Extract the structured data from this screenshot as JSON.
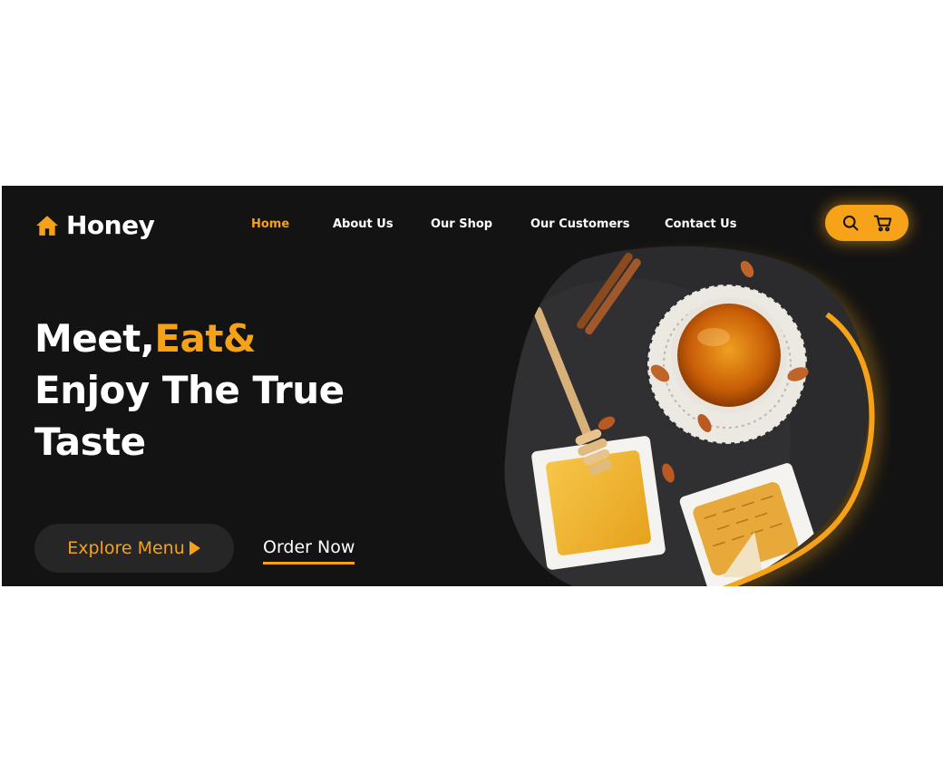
{
  "brand": {
    "name": "Honey",
    "icon": "home-icon",
    "color": "#f5a218"
  },
  "nav": {
    "items": [
      {
        "label": "Home",
        "active": true
      },
      {
        "label": "About Us",
        "active": false
      },
      {
        "label": "Our Shop",
        "active": false
      },
      {
        "label": "Our Customers",
        "active": false
      },
      {
        "label": "Contact Us",
        "active": false
      }
    ]
  },
  "actions": {
    "search_icon": "search-icon",
    "cart_icon": "cart-icon"
  },
  "hero": {
    "line1_white": "Meet,",
    "line1_accent": "Eat&",
    "line2": "Enjoy The True",
    "line3": "Taste"
  },
  "buttons": {
    "explore_label": "Explore Menu",
    "explore_icon": "play-triangle-icon",
    "order_label": "Order Now"
  },
  "colors": {
    "background": "#131313",
    "accent": "#f5a218",
    "button_dark": "#262626"
  }
}
